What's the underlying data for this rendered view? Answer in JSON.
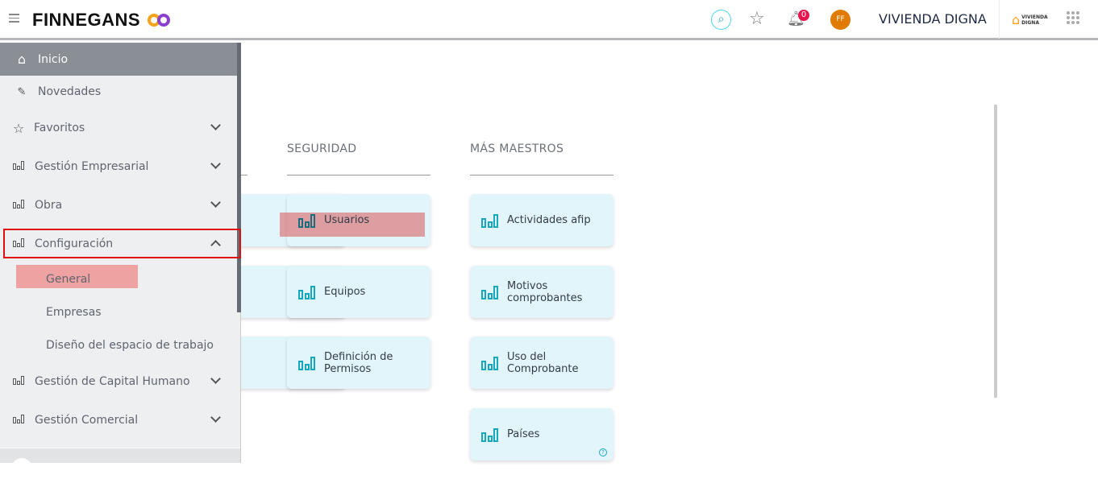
{
  "header": {
    "brand": "FINNEGANS",
    "notifications": "0",
    "avatar": "FF",
    "company": "VIVIENDA DIGNA",
    "company_logo": "VIVIENDA DIGNA"
  },
  "sidebar": {
    "items": [
      {
        "label": "Inicio",
        "icon": "home-icon"
      },
      {
        "label": "Novedades",
        "icon": "pin-icon"
      },
      {
        "label": "Favoritos",
        "icon": "star-icon"
      },
      {
        "label": "Gestión Empresarial",
        "icon": "chart-icon"
      },
      {
        "label": "Obra",
        "icon": "chart-icon"
      },
      {
        "label": "Configuración",
        "icon": "chart-icon"
      },
      {
        "label": "Gestión de Capital Humano",
        "icon": "chart-icon"
      },
      {
        "label": "Gestión Comercial",
        "icon": "chart-icon"
      }
    ],
    "sub": [
      "General",
      "Empresas",
      "Diseño del espacio de trabajo"
    ]
  },
  "sections": [
    {
      "title": "SEGURIDAD",
      "cards": [
        "Usuarios",
        "Equipos",
        "Definición de Permisos"
      ]
    },
    {
      "title": "MÁS MAESTROS",
      "cards": [
        "Actividades afip",
        "Motivos comprobantes",
        "Uso del Comprobante",
        "Países"
      ]
    }
  ],
  "colors": {
    "accent": "#15a6c2",
    "active": "#8a8e95",
    "avatar": "#e07b00",
    "badge": "#e8164f"
  }
}
